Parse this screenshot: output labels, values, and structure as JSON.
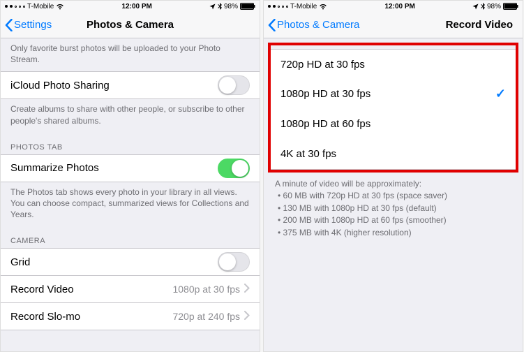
{
  "status": {
    "carrier": "T-Mobile",
    "time": "12:00 PM",
    "battery_pct": "98%"
  },
  "left": {
    "back_label": "Settings",
    "title": "Photos & Camera",
    "burst_note": "Only favorite burst photos will be uploaded to your Photo Stream.",
    "icloud_sharing_label": "iCloud Photo Sharing",
    "icloud_sharing_note": "Create albums to share with other people, or subscribe to other people's shared albums.",
    "photos_tab_header": "PHOTOS TAB",
    "summarize_label": "Summarize Photos",
    "summarize_note": "The Photos tab shows every photo in your library in all views. You can choose compact, summarized views for Collections and Years.",
    "camera_header": "CAMERA",
    "grid_label": "Grid",
    "record_video_label": "Record Video",
    "record_video_value": "1080p at 30 fps",
    "record_slomo_label": "Record Slo-mo",
    "record_slomo_value": "720p at 240 fps"
  },
  "right": {
    "back_label": "Photos & Camera",
    "title": "Record Video",
    "options": {
      "0": {
        "label": "720p HD at 30 fps"
      },
      "1": {
        "label": "1080p HD at 30 fps"
      },
      "2": {
        "label": "1080p HD at 60 fps"
      },
      "3": {
        "label": "4K at 30 fps"
      }
    },
    "selected_index": 1,
    "info_header": "A minute of video will be approximately:",
    "info_lines": {
      "0": "60 MB with 720p HD at 30 fps (space saver)",
      "1": "130 MB with 1080p HD at 30 fps (default)",
      "2": "200 MB with 1080p HD at 60 fps (smoother)",
      "3": "375 MB with 4K (higher resolution)"
    }
  }
}
